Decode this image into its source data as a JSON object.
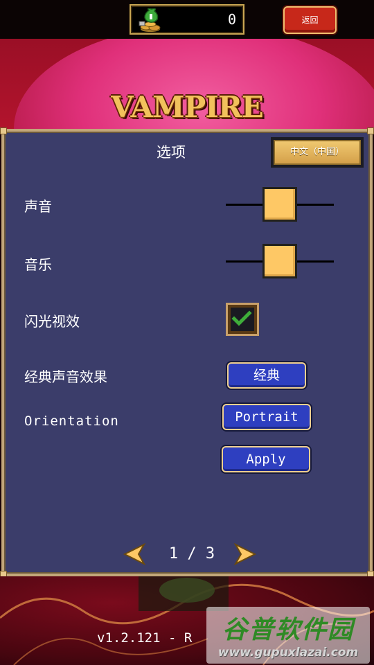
{
  "topbar": {
    "coin_icon": "money-bag-coins-icon",
    "coin_count": "0",
    "back_label": "返回"
  },
  "hero": {
    "logo": "VAMPIRE"
  },
  "options": {
    "title": "选项",
    "language_label": "中文（中国）",
    "sound": {
      "label": "声音",
      "level": 0.5
    },
    "music": {
      "label": "音乐",
      "level": 0.5
    },
    "flash": {
      "label": "闪光视效",
      "checked": true
    },
    "classic_sound": {
      "label": "经典声音效果",
      "value": "经典"
    },
    "orientation": {
      "label": "Orientation",
      "value": "Portrait"
    },
    "apply_label": "Apply",
    "pager": {
      "text": "1 / 3",
      "prev_icon": "arrow-left-icon",
      "next_icon": "arrow-right-icon"
    }
  },
  "footer": {
    "version": "v1.2.121 - R"
  },
  "watermark": {
    "title": "谷普软件园",
    "url": "www.gupuxlazai.com"
  },
  "colors": {
    "panel_bg": "#3b3d6a",
    "panel_border": "#c2a77a",
    "knob": "#fec865",
    "blue_button": "#2e3fc0",
    "back_button": "#c7281a",
    "check_green": "#3fae3a"
  }
}
